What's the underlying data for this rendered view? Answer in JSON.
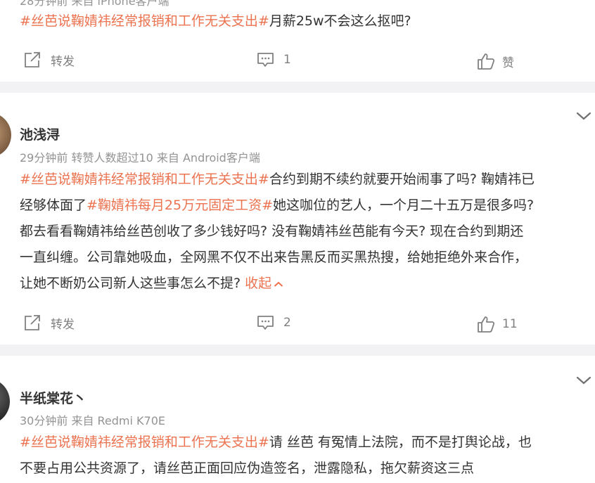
{
  "post0": {
    "meta_partial": "28分钟前 来自 iPhone客户端",
    "content": {
      "topic": "#丝芭说鞠婧祎经常报销和工作无关支出#",
      "text": "月薪25w不会这么抠吧?"
    },
    "actions": {
      "repost_label": "转发",
      "comment_count": "1",
      "like_label": "赞"
    }
  },
  "post1": {
    "username": "池浅浔",
    "meta": "29分钟前 转赞人数超过10  来自 Android客户端",
    "lines": [
      {
        "topic": "#丝芭说鞠婧祎经常报销和工作无关支出#",
        "text": "合约到期不续约就要开始闹事了吗? 鞠婧祎已"
      },
      {
        "pre": "经够体面了",
        "topic": "#鞠婧祎每月25万元固定工资#",
        "text": "她这咖位的艺人，一个月二十五万是很多吗?"
      },
      {
        "text": "都去看看鞠婧祎给丝芭创收了多少钱好吗? 没有鞠婧祎丝芭能有今天? 现在合约到期还"
      },
      {
        "text": "一直纠缠。公司靠她吸血，全网黑不仅不出来告黑反而买黑热搜，给她拒绝外来合作，"
      },
      {
        "text": "让她不断奶公司新人这些事怎么不提? ",
        "collapse": "收起"
      }
    ],
    "actions": {
      "repost_label": "转发",
      "comment_count": "2",
      "like_count": "11"
    }
  },
  "post2": {
    "username": "半纸棠花丶",
    "meta": "30分钟前  来自 Redmi K70E",
    "lines": [
      {
        "topic": "#丝芭说鞠婧祎经常报销和工作无关支出#",
        "text": "请 丝芭 有冤情上法院，而不是打舆论战，也"
      },
      {
        "text": "不要占用公共资源了，请丝芭正面回应伪造签名，泄露隐私，拖欠薪资这三点"
      }
    ]
  },
  "colors": {
    "topic": "#eb7350",
    "meta": "#939393",
    "text": "#333333",
    "separator": "#f2f2f5",
    "icon": "#808080"
  }
}
